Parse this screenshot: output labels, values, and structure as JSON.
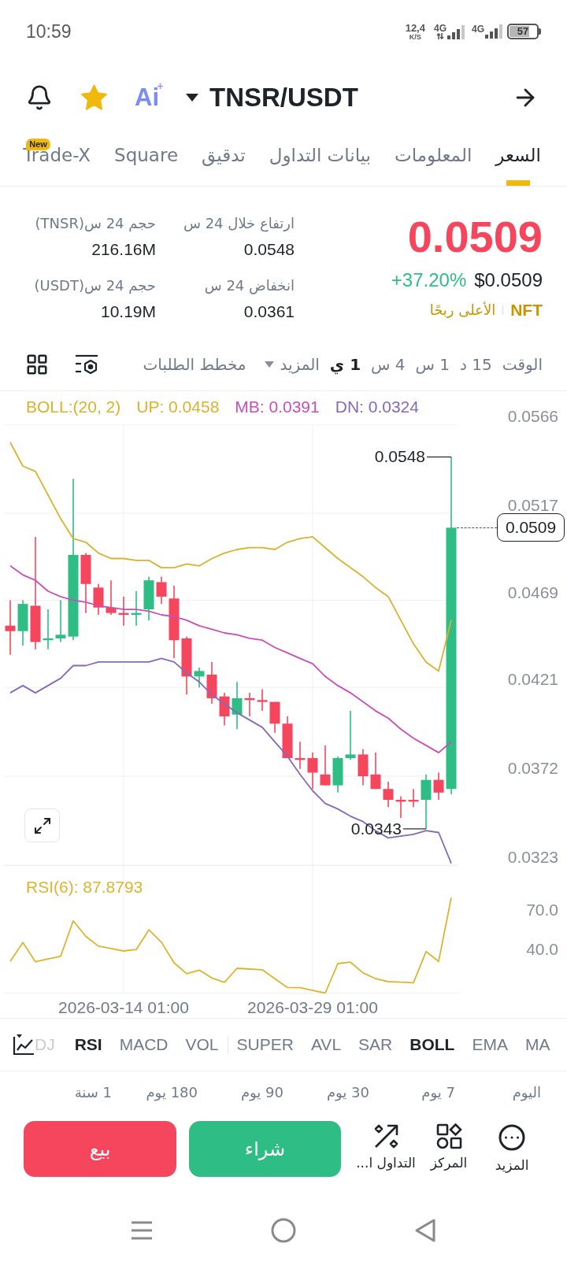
{
  "status_bar": {
    "time": "10:59",
    "network_speed": "12,4",
    "speed_unit": "K/S",
    "sim_1": "4G",
    "sim_2": "4G",
    "battery": "57"
  },
  "header": {
    "favorite": true,
    "ai_label": "Ai",
    "pair": "TNSR/USDT"
  },
  "tabs": [
    {
      "label": "السعر",
      "selected": true
    },
    {
      "label": "المعلومات",
      "selected": false
    },
    {
      "label": "بيانات التداول",
      "selected": false
    },
    {
      "label": "تدقيق",
      "selected": false
    },
    {
      "label": "Square",
      "selected": false
    },
    {
      "label": "Trade-X",
      "selected": false,
      "badge": "New"
    }
  ],
  "price": {
    "last": "0.0509",
    "change": "+37.20%",
    "usd_price": "$0.0509",
    "tag": "NFT",
    "tag_note": "الأعلى ربحًا"
  },
  "stats": [
    {
      "label": "ارتفاع خلال 24 س",
      "value": "0.0548"
    },
    {
      "label": "حجم 24 س(TNSR)",
      "value": "216.16M"
    },
    {
      "label": "انخفاض 24 س",
      "value": "0.0361"
    },
    {
      "label": "حجم 24 س(USDT)",
      "value": "10.19M"
    }
  ],
  "timeframe_bar": {
    "label": "الوقت",
    "options": [
      {
        "label": "15 د",
        "selected": false
      },
      {
        "label": "1 س",
        "selected": false
      },
      {
        "label": "4 س",
        "selected": false
      },
      {
        "label": "1 ي",
        "selected": true
      }
    ],
    "more": "المزيد",
    "depth_chart": "مخطط الطلبات"
  },
  "chart": {
    "legend": [
      {
        "text": "DN: 0.0324",
        "color": "#8669b8"
      },
      {
        "text": "MB: 0.0391",
        "color": "#c94fb7"
      },
      {
        "text": "UP: 0.0458",
        "color": "#d9b22e"
      },
      {
        "text": "BOLL:(20, 2)",
        "color": "#d9b22e"
      }
    ],
    "last_price": "0.0509",
    "high_label": "0.0548",
    "low_label": "0.0343",
    "chart_data": {
      "type": "candlestick",
      "grid": true,
      "categories": [
        null,
        null,
        null,
        null,
        null,
        null,
        null,
        null,
        null,
        null,
        null,
        null,
        null,
        null,
        null,
        null,
        null,
        null,
        null,
        null,
        null,
        null,
        null,
        null,
        null,
        null,
        null,
        null,
        null,
        null,
        null,
        null,
        null,
        null,
        null,
        null
      ],
      "ylim": [
        0.0323,
        0.0566
      ],
      "yticks": [
        0.0566,
        0.0517,
        0.0469,
        0.0421,
        0.0372,
        0.0323
      ],
      "ohlc": [
        [
          0.0455,
          0.0469,
          0.0439,
          0.0452
        ],
        [
          0.0452,
          0.0469,
          0.0444,
          0.0467
        ],
        [
          0.0466,
          0.0504,
          0.0442,
          0.0446
        ],
        [
          0.0447,
          0.0464,
          0.0442,
          0.0448
        ],
        [
          0.0448,
          0.0469,
          0.0446,
          0.045
        ],
        [
          0.0449,
          0.0536,
          0.0447,
          0.0494
        ],
        [
          0.0494,
          0.0495,
          0.0462,
          0.0478
        ],
        [
          0.0476,
          0.0478,
          0.0461,
          0.0465
        ],
        [
          0.0465,
          0.048,
          0.0461,
          0.0462
        ],
        [
          0.0462,
          0.0471,
          0.0455,
          0.0461
        ],
        [
          0.0461,
          0.0474,
          0.0455,
          0.0462
        ],
        [
          0.0464,
          0.0482,
          0.0458,
          0.048
        ],
        [
          0.0479,
          0.0482,
          0.0467,
          0.0471
        ],
        [
          0.047,
          0.0477,
          0.0437,
          0.0447
        ],
        [
          0.0448,
          0.0449,
          0.0417,
          0.0427
        ],
        [
          0.0427,
          0.0432,
          0.0421,
          0.043
        ],
        [
          0.0428,
          0.0435,
          0.0412,
          0.0415
        ],
        [
          0.0416,
          0.0418,
          0.04,
          0.0405
        ],
        [
          0.0406,
          0.0424,
          0.0398,
          0.0415
        ],
        [
          0.0415,
          0.0418,
          0.0405,
          0.0414
        ],
        [
          0.0414,
          0.042,
          0.0408,
          0.0413
        ],
        [
          0.0413,
          0.0413,
          0.0396,
          0.0401
        ],
        [
          0.0401,
          0.0405,
          0.0382,
          0.0382
        ],
        [
          0.0382,
          0.0391,
          0.0376,
          0.0381
        ],
        [
          0.0382,
          0.0385,
          0.0365,
          0.0374
        ],
        [
          0.0373,
          0.0389,
          0.0367,
          0.0367
        ],
        [
          0.0367,
          0.0383,
          0.0363,
          0.0382
        ],
        [
          0.0382,
          0.0408,
          0.0381,
          0.0384
        ],
        [
          0.0384,
          0.0387,
          0.0367,
          0.0372
        ],
        [
          0.0373,
          0.0385,
          0.0365,
          0.0365
        ],
        [
          0.0365,
          0.0369,
          0.0355,
          0.0359
        ],
        [
          0.0359,
          0.0361,
          0.0349,
          0.0358
        ],
        [
          0.0359,
          0.0365,
          0.0355,
          0.0358
        ],
        [
          0.0359,
          0.0373,
          0.0343,
          0.037
        ],
        [
          0.037,
          0.0374,
          0.0359,
          0.0363
        ],
        [
          0.0365,
          0.0548,
          0.0362,
          0.0509
        ]
      ],
      "series": [
        {
          "type": "line",
          "color": "#d9b22e",
          "values": [
            0.0556,
            0.0543,
            0.054,
            0.0527,
            0.0514,
            0.0503,
            0.0501,
            0.0495,
            0.0492,
            0.0492,
            0.0491,
            0.0491,
            0.0487,
            0.0487,
            0.0489,
            0.0488,
            0.0492,
            0.0495,
            0.0497,
            0.0498,
            0.0498,
            0.0497,
            0.0501,
            0.0503,
            0.0504,
            0.0498,
            0.0492,
            0.0487,
            0.0482,
            0.0476,
            0.0471,
            0.0458,
            0.0445,
            0.0435,
            0.043,
            0.0458
          ]
        },
        {
          "type": "line",
          "color": "#c94fb7",
          "values": [
            0.0488,
            0.0483,
            0.048,
            0.0474,
            0.0471,
            0.0469,
            0.0468,
            0.0466,
            0.0465,
            0.0464,
            0.0464,
            0.0463,
            0.0461,
            0.046,
            0.0458,
            0.0455,
            0.0453,
            0.0451,
            0.045,
            0.0448,
            0.0447,
            0.0443,
            0.044,
            0.0437,
            0.0434,
            0.0427,
            0.0422,
            0.0418,
            0.0413,
            0.0408,
            0.0404,
            0.0398,
            0.0393,
            0.0389,
            0.0385,
            0.0391
          ]
        },
        {
          "type": "line",
          "color": "#8669b8",
          "values": [
            0.0418,
            0.0422,
            0.0418,
            0.0422,
            0.0426,
            0.0433,
            0.0433,
            0.0435,
            0.0435,
            0.0435,
            0.0435,
            0.0435,
            0.0437,
            0.0435,
            0.0429,
            0.0424,
            0.0417,
            0.0412,
            0.0407,
            0.0403,
            0.0399,
            0.0391,
            0.0383,
            0.0373,
            0.0364,
            0.0357,
            0.0354,
            0.035,
            0.0347,
            0.0342,
            0.0338,
            0.0339,
            0.034,
            0.0342,
            0.0341,
            0.0324
          ]
        }
      ]
    }
  },
  "rsi": {
    "label": "RSI(6): 87.8793",
    "chart_data": {
      "type": "line",
      "categories": [
        null,
        null,
        null,
        null,
        null,
        null,
        null,
        null,
        null,
        "2026-03-14 01:00",
        null,
        null,
        null,
        null,
        null,
        null,
        null,
        null,
        null,
        null,
        null,
        null,
        null,
        null,
        "2026-03-29 01:00",
        null,
        null,
        null,
        null,
        null,
        null,
        null,
        null,
        null,
        null,
        null
      ],
      "ylim": [
        5.8,
        104.5
      ],
      "yticks": [
        {
          "value": 70,
          "label": "70.0"
        },
        {
          "value": 40,
          "label": "40.0"
        }
      ],
      "series": [
        {
          "color": "#dcb52f",
          "values": [
            30.5,
            45.0,
            30.2,
            32.3,
            34.4,
            61.6,
            49.7,
            42.2,
            40.4,
            38.5,
            39.6,
            54.7,
            45.2,
            29.4,
            21.0,
            23.8,
            17.7,
            14.4,
            25.2,
            24.6,
            24.1,
            17.2,
            10.4,
            10.2,
            8.1,
            6.1,
            28.8,
            29.9,
            21.6,
            17.2,
            14.9,
            14.5,
            14.1,
            38.0,
            30.5,
            79.5
          ]
        }
      ]
    }
  },
  "indicator_bar": {
    "main_indicators": [
      {
        "label": "MA",
        "selected": false
      },
      {
        "label": "EMA",
        "selected": false
      },
      {
        "label": "BOLL",
        "selected": true
      },
      {
        "label": "SAR",
        "selected": false
      },
      {
        "label": "AVL",
        "selected": false
      },
      {
        "label": "SUPER",
        "selected": false
      }
    ],
    "sub_indicators": [
      {
        "label": "VOL",
        "selected": false
      },
      {
        "label": "MACD",
        "selected": false
      },
      {
        "label": "RSI",
        "selected": true
      }
    ],
    "clipped": "DJ"
  },
  "period_changes": [
    "اليوم",
    "7 يوم",
    "30 يوم",
    "90 يوم",
    "180 يوم",
    "1 سنة"
  ],
  "actions": {
    "shortcuts": [
      {
        "kind": "more",
        "label": "المزيد"
      },
      {
        "kind": "position",
        "label": "المركز"
      },
      {
        "kind": "trade",
        "label": "التداول ا..."
      }
    ],
    "buy": "شراء",
    "sell": "بيع"
  }
}
